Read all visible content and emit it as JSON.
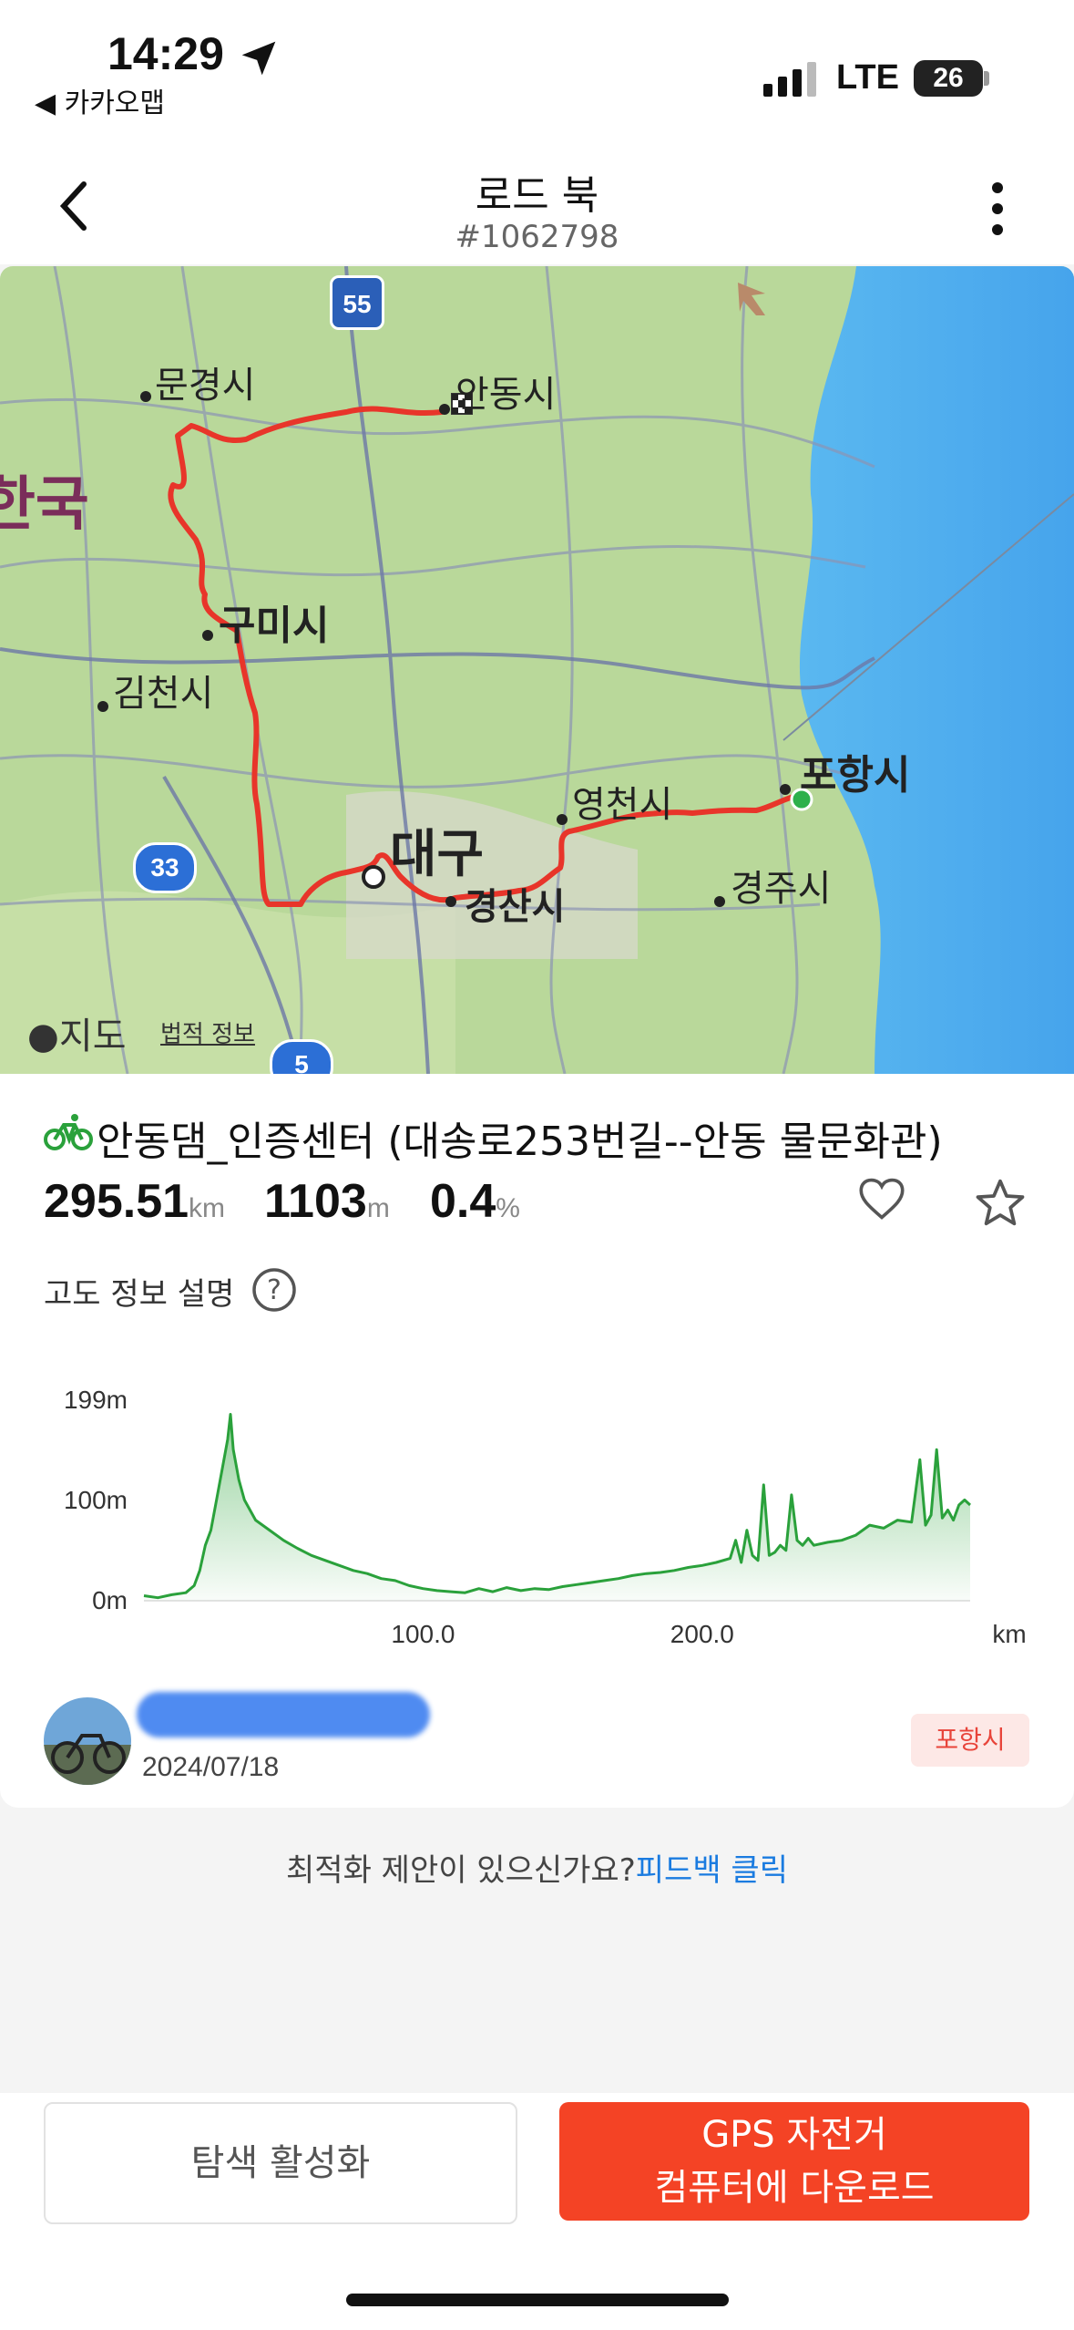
{
  "status": {
    "time": "14:29",
    "back_app": "◀ 카카오맵",
    "network": "LTE",
    "battery": "26"
  },
  "header": {
    "title": "로드 북",
    "subtitle": "#1062798"
  },
  "map": {
    "cities": [
      "안동시",
      "문경시",
      "구미시",
      "김천시",
      "대구",
      "경산시",
      "영천시",
      "포항시",
      "경주시"
    ],
    "country_fragment": "한국",
    "highway_shields": [
      "55",
      "33",
      "5"
    ],
    "attribution_brand": "지도",
    "attribution_legal": "법적 정보",
    "route_color": "#e8352a",
    "start_color": "#2db04b"
  },
  "route": {
    "name": "안동댐_인증센터 (대송로253번길--안동 물문화관)",
    "distance": "295.51",
    "distance_unit": "km",
    "elevation_gain": "1103",
    "elevation_unit": "m",
    "grade": "0.4",
    "grade_unit": "%"
  },
  "elevation_info_label": "고도 정보 설명",
  "chart_data": {
    "type": "area",
    "x_unit": "km",
    "y_ticks": [
      "199m",
      "100m",
      "0m"
    ],
    "x_ticks": [
      "100.0",
      "200.0"
    ],
    "xlim": [
      0,
      296
    ],
    "ylim": [
      0,
      199
    ],
    "color": "#2aa13b",
    "x": [
      0,
      5,
      10,
      15,
      18,
      20,
      22,
      24,
      26,
      28,
      30,
      31,
      32,
      34,
      36,
      40,
      45,
      50,
      55,
      60,
      65,
      70,
      75,
      80,
      85,
      90,
      95,
      100,
      105,
      110,
      115,
      120,
      125,
      130,
      135,
      140,
      145,
      150,
      155,
      160,
      165,
      170,
      175,
      180,
      185,
      190,
      195,
      200,
      205,
      210,
      212,
      214,
      216,
      218,
      220,
      222,
      224,
      226,
      228,
      230,
      232,
      234,
      236,
      238,
      240,
      245,
      250,
      255,
      260,
      265,
      270,
      275,
      278,
      280,
      282,
      284,
      286,
      288,
      290,
      292,
      294,
      296
    ],
    "y": [
      5,
      3,
      6,
      8,
      15,
      30,
      55,
      70,
      100,
      130,
      160,
      185,
      150,
      120,
      100,
      80,
      70,
      60,
      52,
      45,
      40,
      35,
      30,
      27,
      22,
      20,
      15,
      12,
      10,
      9,
      8,
      12,
      9,
      13,
      10,
      12,
      11,
      14,
      16,
      18,
      20,
      22,
      25,
      27,
      28,
      30,
      33,
      35,
      38,
      42,
      60,
      38,
      70,
      45,
      40,
      115,
      45,
      48,
      55,
      50,
      105,
      60,
      55,
      62,
      55,
      58,
      60,
      65,
      75,
      72,
      80,
      78,
      140,
      75,
      85,
      150,
      82,
      90,
      80,
      95,
      100,
      95
    ]
  },
  "author": {
    "date": "2024/07/18",
    "city_tag": "포항시"
  },
  "feedback": {
    "text": "최적화 제안이 있으신가요?",
    "link": "피드백 클릭"
  },
  "buttons": {
    "explore": "탐색 활성화",
    "gps_line1": "GPS 자전거",
    "gps_line2": "컴퓨터에 다운로드"
  }
}
